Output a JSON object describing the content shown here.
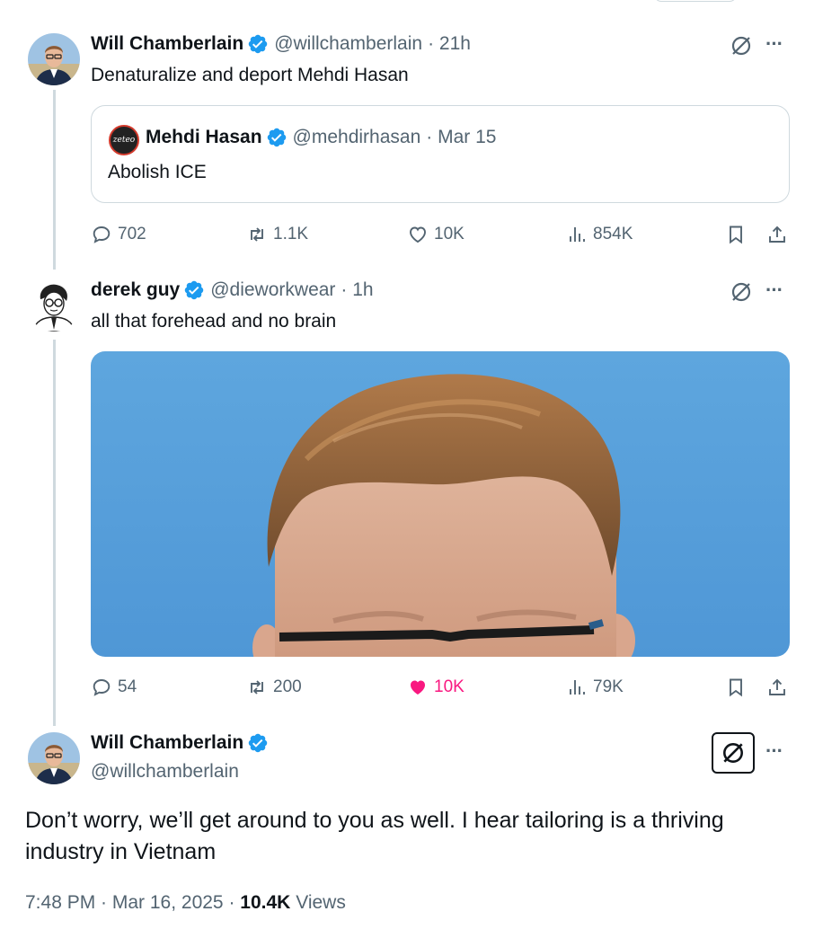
{
  "tweets": [
    {
      "name": "Will Chamberlain",
      "handle": "@willchamberlain",
      "time": "· 21h",
      "text": "Denaturalize and deport Mehdi Hasan",
      "quote": {
        "avatar_text": "zeteo",
        "name": "Mehdi Hasan",
        "handle": "@mehdirhasan",
        "time": "· Mar 15",
        "text": "Abolish ICE"
      },
      "stats": {
        "replies": "702",
        "reposts": "1.1K",
        "likes": "10K",
        "views": "854K"
      }
    },
    {
      "name": "derek guy",
      "handle": "@dieworkwear",
      "time": "· 1h",
      "text": "all that forehead and no brain",
      "stats": {
        "replies": "54",
        "reposts": "200",
        "likes": "10K",
        "views": "79K"
      },
      "liked": true
    }
  ],
  "main_tweet": {
    "name": "Will Chamberlain",
    "handle": "@willchamberlain",
    "text": "Don’t worry, we’ll get around to you as well. I hear tailoring is a thriving industry in Vietnam",
    "time": "7:48 PM · Mar 16, 2025 ·",
    "views_count": "10.4K",
    "views_label": "Views"
  },
  "more_label": "···",
  "colors": {
    "verified": "#1d9bf0",
    "like": "#f91880",
    "secondary": "#536471",
    "border": "#cfd9de",
    "sky": "#5aa3dd"
  },
  "icons": [
    "reply-icon",
    "repost-icon",
    "like-icon",
    "views-icon",
    "bookmark-icon",
    "share-icon",
    "grok-icon",
    "verified-icon",
    "more-icon"
  ]
}
